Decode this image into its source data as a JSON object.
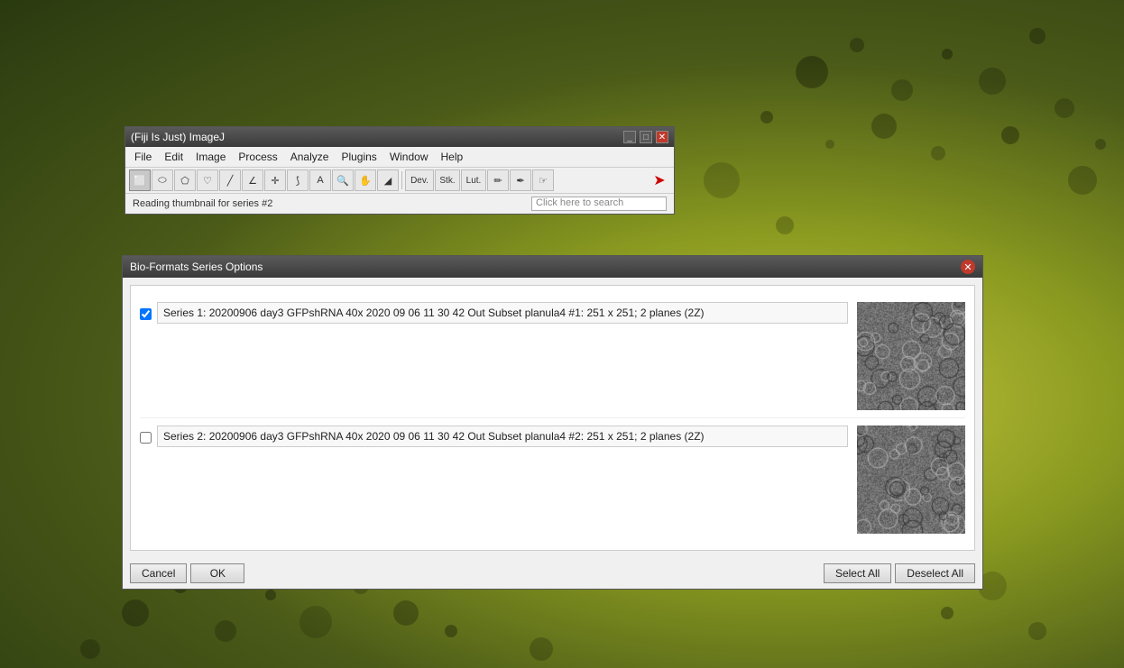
{
  "background": {
    "color_start": "#c8c840",
    "color_end": "#2a3a10"
  },
  "imagej_window": {
    "title": "(Fiji Is Just) ImageJ",
    "menu_items": [
      "File",
      "Edit",
      "Image",
      "Process",
      "Analyze",
      "Plugins",
      "Window",
      "Help"
    ],
    "toolbar_tools": [
      {
        "name": "rectangle",
        "symbol": "⬜"
      },
      {
        "name": "oval",
        "symbol": "⬭"
      },
      {
        "name": "polygon",
        "symbol": "⬠"
      },
      {
        "name": "freehand",
        "symbol": "♡"
      },
      {
        "name": "line",
        "symbol": "╱"
      },
      {
        "name": "angle",
        "symbol": "∠"
      },
      {
        "name": "point",
        "symbol": "✛"
      },
      {
        "name": "wand",
        "symbol": "⟆"
      },
      {
        "name": "text",
        "symbol": "A"
      },
      {
        "name": "magnify",
        "symbol": "🔍"
      },
      {
        "name": "hand",
        "symbol": "✋"
      },
      {
        "name": "dropper",
        "symbol": "◢"
      }
    ],
    "special_buttons": [
      "Dev.",
      "Stk.",
      "Lut.",
      "✏",
      "✒",
      "☞"
    ],
    "arrow": "➤",
    "status_text": "Reading thumbnail for series #2",
    "search_placeholder": "Click here to search"
  },
  "bioformats_dialog": {
    "title": "Bio-Formats Series Options",
    "series": [
      {
        "id": "series1",
        "checked": true,
        "label": "Series 1: 20200906 day3 GFPshRNA 40x 2020 09 06  11 30 42 Out Subset planula4 #1: 251 x 251; 2 planes (2Z)"
      },
      {
        "id": "series2",
        "checked": false,
        "label": "Series 2: 20200906 day3 GFPshRNA 40x 2020 09 06  11 30 42 Out Subset planula4 #2: 251 x 251; 2 planes (2Z)"
      }
    ],
    "buttons": {
      "cancel": "Cancel",
      "ok": "OK",
      "select_all": "Select All",
      "deselect_all": "Deselect All"
    }
  }
}
